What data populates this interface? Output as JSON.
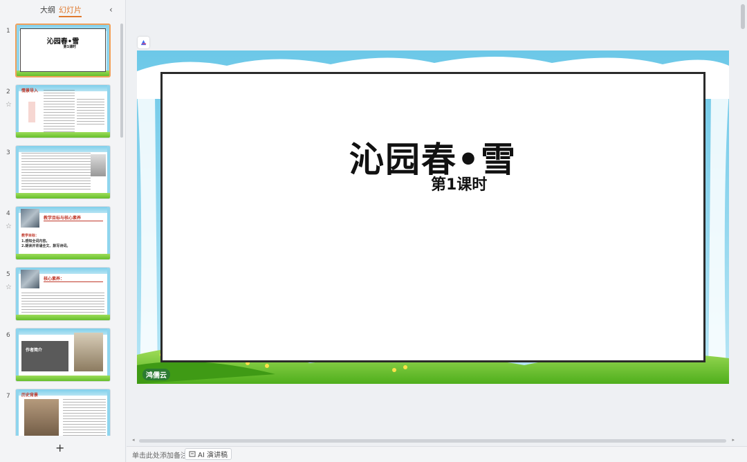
{
  "panel": {
    "tabs": [
      {
        "label": "大纲"
      },
      {
        "label": "幻灯片"
      }
    ],
    "active_tab": "幻灯片",
    "add_slide_symbol": "+"
  },
  "thumbnails": [
    {
      "num": "1",
      "title": "沁园春•雪",
      "sub": "第1课时"
    },
    {
      "num": "2",
      "label": "情景导入"
    },
    {
      "num": "3"
    },
    {
      "num": "4",
      "label": "教学目标与核心素养",
      "text1": "教学目标：",
      "text2": "1.感知全词内容。",
      "text3": "2.朗读并背诵全文、默写诗词。"
    },
    {
      "num": "5",
      "label": "核心素养："
    },
    {
      "num": "6",
      "label": "作者简介"
    },
    {
      "num": "7",
      "label": "历史背景"
    }
  ],
  "slide": {
    "title": "沁园春•雪",
    "subtitle": "第1课时",
    "logo": "鸿儒云"
  },
  "bottom": {
    "notes_placeholder": "单击此处添加备注",
    "ai_notes_label": "AI 演讲稿"
  },
  "colors": {
    "accent": "#e07a2e",
    "sky": "#8fd5ee",
    "grass": "#66bf2c"
  }
}
